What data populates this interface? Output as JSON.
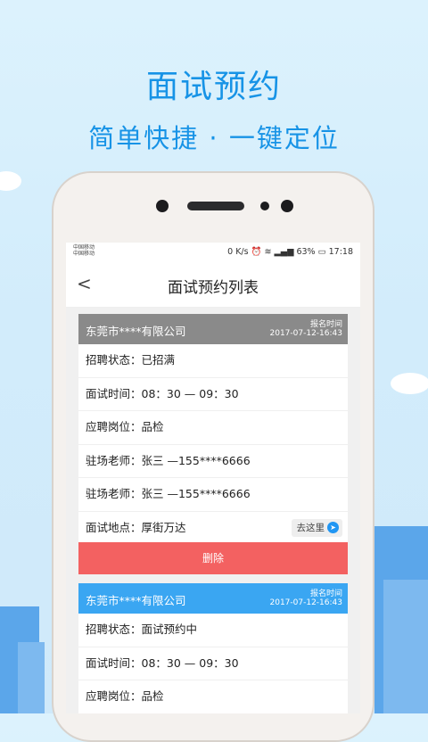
{
  "promo": {
    "title": "面试预约",
    "subtitle": "简单快捷 · 一键定位"
  },
  "status_bar": {
    "carrier1": "中国移动",
    "carrier2": "中国移动",
    "speed": "0 K/s",
    "battery": "63%",
    "time": "17:18"
  },
  "nav": {
    "back_icon": "chevron-left-icon",
    "title": "面试预约列表"
  },
  "cards": [
    {
      "company": "东莞市****有限公司",
      "reg_label": "报名时间",
      "reg_time": "2017-07-12-16:43",
      "header_color": "#8a8a8a",
      "rows": [
        "招聘状态：已招满",
        "面试时间：08：30 — 09：30",
        "应聘岗位：品检",
        "驻场老师：张三 —155****6666",
        "驻场老师：张三 —155****6666",
        "面试地点：厚街万达"
      ],
      "goto_label": "去这里",
      "delete_label": "删除"
    },
    {
      "company": "东莞市****有限公司",
      "reg_label": "报名时间",
      "reg_time": "2017-07-12-16:43",
      "header_color": "#3aa6f2",
      "rows": [
        "招聘状态：面试预约中",
        "面试时间：08：30 — 09：30",
        "应聘岗位：品检"
      ]
    }
  ],
  "colors": {
    "accent": "#1793e6",
    "delete": "#f36161"
  }
}
